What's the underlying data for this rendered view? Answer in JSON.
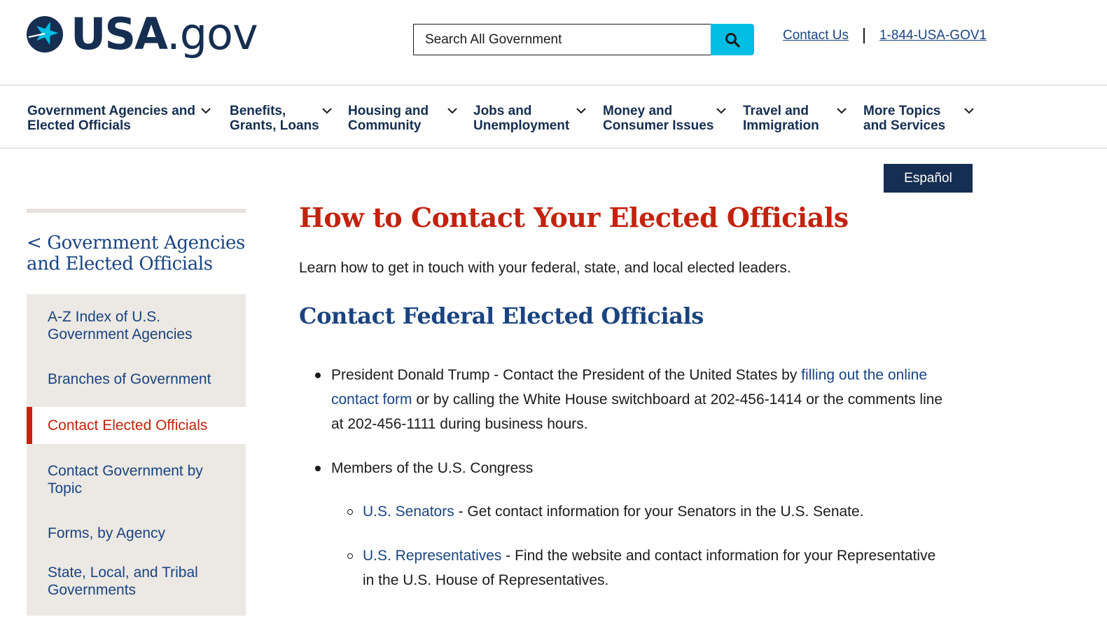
{
  "header": {
    "logo_text": "USA",
    "logo_suffix": ".gov",
    "search_placeholder": "Search All Government",
    "contact_us": "Contact Us",
    "phone": "1-844-USA-GOV1"
  },
  "nav": {
    "items": [
      {
        "label": "Government Agencies and\nElected Officials"
      },
      {
        "label": "Benefits,\nGrants, Loans"
      },
      {
        "label": "Housing and\nCommunity"
      },
      {
        "label": "Jobs and\nUnemployment"
      },
      {
        "label": "Money and\nConsumer Issues"
      },
      {
        "label": "Travel and\nImmigration"
      },
      {
        "label": "More Topics\nand Services"
      }
    ]
  },
  "espanol_label": "Español",
  "sidebar": {
    "parent_label": "< Government Agencies and Elected Officials",
    "items": [
      {
        "label": "A-Z Index of U.S. Government Agencies"
      },
      {
        "label": "Branches of Government"
      },
      {
        "label": "Contact Elected Officials",
        "active": true
      },
      {
        "label": "Contact Government by Topic"
      },
      {
        "label": "Forms, by Agency"
      },
      {
        "label": "State, Local, and Tribal Governments"
      }
    ]
  },
  "main": {
    "title": "How to Contact Your Elected Officials",
    "intro": "Learn how to get in touch with your federal, state, and local elected leaders.",
    "section_heading": "Contact Federal Elected Officials",
    "president": {
      "before_link": "President Donald Trump - Contact the President of the United States by ",
      "link_part1": "filling out the online",
      "link_part2": "contact form",
      "after_link_line2": " or by calling the White House switchboard at 202-456-1414 or the comments line",
      "line3": "at 202-456-1111 during business hours."
    },
    "congress_label": "Members of the U.S. Congress",
    "senators": {
      "link": "U.S. Senators",
      "text": " - Get contact information for your Senators in the U.S. Senate."
    },
    "representatives": {
      "link": "U.S. Representatives",
      "text_line1": " - Find the website and contact information for your Representative",
      "text_line2": "in the U.S. House of Representatives."
    }
  },
  "colors": {
    "navy": "#162e51",
    "link_blue": "#1a4480",
    "accent_red": "#c2230f",
    "search_cyan": "#00bde3",
    "sidebar_bg": "#ece8e3"
  }
}
